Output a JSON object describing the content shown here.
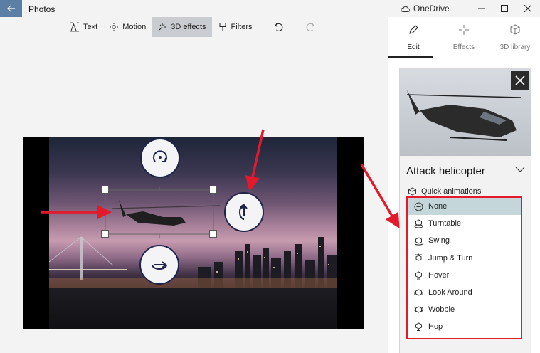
{
  "titlebar": {
    "app_title": "Photos",
    "onedrive_label": "OneDrive"
  },
  "toolbar": {
    "items": [
      {
        "label": "Text",
        "icon": "text-icon"
      },
      {
        "label": "Motion",
        "icon": "motion-icon"
      },
      {
        "label": "3D effects",
        "icon": "3d-effects-icon",
        "active": true
      },
      {
        "label": "Filters",
        "icon": "filters-icon"
      }
    ]
  },
  "panel": {
    "tabs": [
      {
        "label": "Edit",
        "icon": "pencil-icon",
        "active": true
      },
      {
        "label": "Effects",
        "icon": "sparkle-icon"
      },
      {
        "label": "3D library",
        "icon": "cube-icon"
      }
    ],
    "card": {
      "title": "Attack helicopter",
      "quick_animations_label": "Quick animations"
    }
  },
  "animations": {
    "items": [
      {
        "label": "None",
        "icon": "none-icon",
        "selected": true
      },
      {
        "label": "Turntable",
        "icon": "turntable-icon"
      },
      {
        "label": "Swing",
        "icon": "swing-icon"
      },
      {
        "label": "Jump & Turn",
        "icon": "jump-turn-icon"
      },
      {
        "label": "Hover",
        "icon": "hover-icon"
      },
      {
        "label": "Look Around",
        "icon": "look-around-icon"
      },
      {
        "label": "Wobble",
        "icon": "wobble-icon"
      },
      {
        "label": "Hop",
        "icon": "hop-icon"
      }
    ]
  },
  "colors": {
    "accent": "#5b7fa4",
    "highlight": "#e3192c",
    "selected_row": "#c4d6da"
  }
}
